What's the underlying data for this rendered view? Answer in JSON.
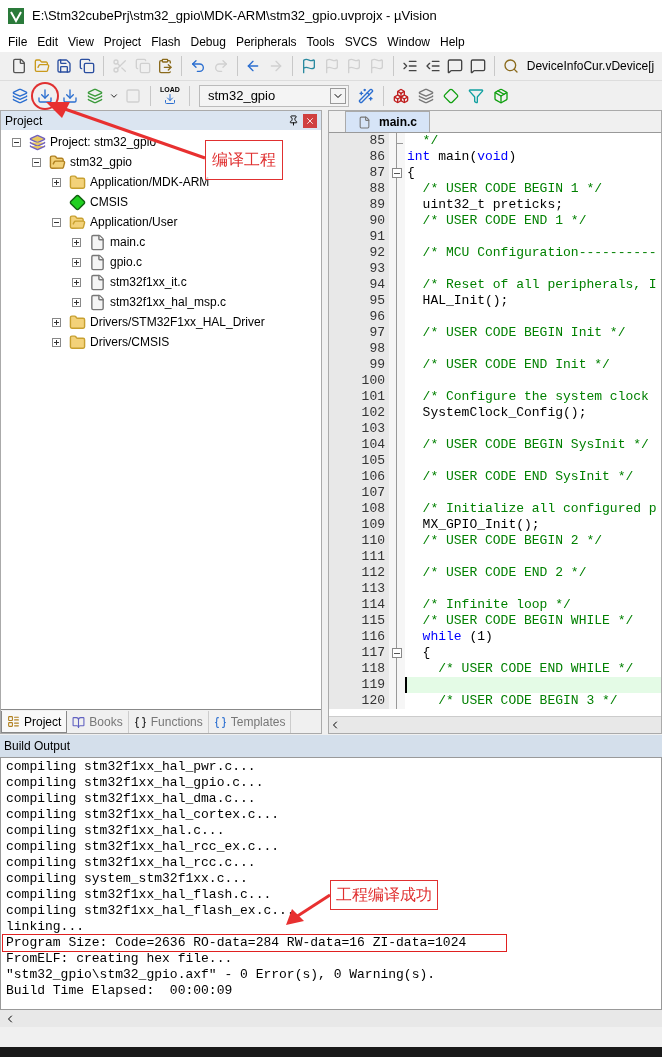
{
  "window": {
    "title": "E:\\Stm32cubePrj\\stm32_gpio\\MDK-ARM\\stm32_gpio.uvprojx - µVision"
  },
  "menu": [
    {
      "label": "File"
    },
    {
      "label": "Edit"
    },
    {
      "label": "View"
    },
    {
      "label": "Project"
    },
    {
      "label": "Flash"
    },
    {
      "label": "Debug"
    },
    {
      "label": "Peripherals"
    },
    {
      "label": "Tools"
    },
    {
      "label": "SVCS"
    },
    {
      "label": "Window"
    },
    {
      "label": "Help"
    }
  ],
  "toolbar1": {
    "buttons": [
      {
        "kind": "new",
        "disabled": false
      },
      {
        "kind": "open",
        "disabled": false
      },
      {
        "kind": "save",
        "disabled": false
      },
      {
        "kind": "saveall",
        "disabled": false
      },
      {
        "kind": "sep"
      },
      {
        "kind": "cut",
        "disabled": true
      },
      {
        "kind": "copy",
        "disabled": true
      },
      {
        "kind": "paste",
        "disabled": false
      },
      {
        "kind": "sep"
      },
      {
        "kind": "undo",
        "disabled": false
      },
      {
        "kind": "redo",
        "disabled": true
      },
      {
        "kind": "sep"
      },
      {
        "kind": "back",
        "disabled": false
      },
      {
        "kind": "forward",
        "disabled": true
      },
      {
        "kind": "sep"
      },
      {
        "kind": "flag",
        "disabled": false
      },
      {
        "kind": "flag",
        "disabled": true
      },
      {
        "kind": "flag",
        "disabled": true
      },
      {
        "kind": "flag",
        "disabled": true
      },
      {
        "kind": "sep"
      },
      {
        "kind": "indent",
        "disabled": false
      },
      {
        "kind": "outdent",
        "disabled": false
      },
      {
        "kind": "comment",
        "disabled": false
      },
      {
        "kind": "comment",
        "disabled": false
      },
      {
        "kind": "sep"
      },
      {
        "kind": "findfolder",
        "disabled": false
      }
    ],
    "device_text": "DeviceInfoCur.vDevice[j"
  },
  "toolbar2": {
    "buttons": [
      {
        "kind": "translate",
        "disabled": false
      },
      {
        "kind": "build",
        "disabled": false,
        "circled": true
      },
      {
        "kind": "rebuild",
        "disabled": false
      },
      {
        "kind": "batch",
        "disabled": false
      },
      {
        "kind": "caret"
      },
      {
        "kind": "stop",
        "disabled": true
      },
      {
        "kind": "sep"
      },
      {
        "kind": "load",
        "disabled": false,
        "label": "LOAD"
      },
      {
        "kind": "sep"
      },
      {
        "kind": "target",
        "value": "stm32_gpio"
      },
      {
        "kind": "wand",
        "disabled": false
      },
      {
        "kind": "sep"
      },
      {
        "kind": "rte",
        "disabled": false
      },
      {
        "kind": "multi",
        "disabled": false
      },
      {
        "kind": "diamond",
        "disabled": false
      },
      {
        "kind": "funnel",
        "disabled": false
      },
      {
        "kind": "pack",
        "disabled": false
      }
    ]
  },
  "project_panel": {
    "title": "Project",
    "tree": [
      {
        "label": "Project: stm32_gpio",
        "kind": "project",
        "expanded": true,
        "children": [
          {
            "label": "stm32_gpio",
            "kind": "target",
            "expanded": true,
            "children": [
              {
                "label": "Application/MDK-ARM",
                "kind": "folder",
                "expanded": false
              },
              {
                "label": "CMSIS",
                "kind": "component"
              },
              {
                "label": "Application/User",
                "kind": "folder",
                "expanded": true,
                "children": [
                  {
                    "label": "main.c",
                    "kind": "file",
                    "expanded": false
                  },
                  {
                    "label": "gpio.c",
                    "kind": "file",
                    "expanded": false
                  },
                  {
                    "label": "stm32f1xx_it.c",
                    "kind": "file",
                    "expanded": false
                  },
                  {
                    "label": "stm32f1xx_hal_msp.c",
                    "kind": "file",
                    "expanded": false
                  }
                ]
              },
              {
                "label": "Drivers/STM32F1xx_HAL_Driver",
                "kind": "folder",
                "expanded": false
              },
              {
                "label": "Drivers/CMSIS",
                "kind": "folder",
                "expanded": false
              }
            ]
          }
        ]
      }
    ],
    "tabs": [
      {
        "label": "Project",
        "kind": "project",
        "selected": true
      },
      {
        "label": "Books",
        "kind": "books",
        "selected": false
      },
      {
        "label": "Functions",
        "kind": "functions",
        "selected": false
      },
      {
        "label": "Templates",
        "kind": "templates",
        "selected": false
      }
    ]
  },
  "editor": {
    "tabs": [
      {
        "label": "main.c",
        "selected": true
      }
    ],
    "lines": [
      {
        "number": "85",
        "kind": "fold_end",
        "segments": [
          {
            "text": "  */",
            "kind": "comment"
          }
        ]
      },
      {
        "number": "86",
        "segments": [
          {
            "text": "int",
            "kind": "keyword"
          },
          {
            "text": " main(",
            "kind": "code"
          },
          {
            "text": "void",
            "kind": "keyword"
          },
          {
            "text": ")",
            "kind": "code"
          }
        ]
      },
      {
        "number": "87",
        "kind": "fold_start",
        "segments": [
          {
            "text": "{",
            "kind": "code"
          }
        ]
      },
      {
        "number": "88",
        "segments": [
          {
            "text": "  /* USER CODE BEGIN 1 */",
            "kind": "comment"
          }
        ]
      },
      {
        "number": "89",
        "segments": [
          {
            "text": "  uint32_t preticks;",
            "kind": "code"
          }
        ]
      },
      {
        "number": "90",
        "segments": [
          {
            "text": "  /* USER CODE END 1 */",
            "kind": "comment"
          }
        ]
      },
      {
        "number": "91"
      },
      {
        "number": "92",
        "segments": [
          {
            "text": "  /* MCU Configuration----------",
            "kind": "comment"
          }
        ]
      },
      {
        "number": "93"
      },
      {
        "number": "94",
        "segments": [
          {
            "text": "  /* Reset of all peripherals, I",
            "kind": "comment"
          }
        ]
      },
      {
        "number": "95",
        "segments": [
          {
            "text": "  HAL_Init();",
            "kind": "code"
          }
        ]
      },
      {
        "number": "96"
      },
      {
        "number": "97",
        "segments": [
          {
            "text": "  /* USER CODE BEGIN Init */",
            "kind": "comment"
          }
        ]
      },
      {
        "number": "98"
      },
      {
        "number": "99",
        "segments": [
          {
            "text": "  /* USER CODE END Init */",
            "kind": "comment"
          }
        ]
      },
      {
        "number": "100"
      },
      {
        "number": "101",
        "segments": [
          {
            "text": "  /* Configure the system clock",
            "kind": "comment"
          }
        ]
      },
      {
        "number": "102",
        "segments": [
          {
            "text": "  SystemClock_Config();",
            "kind": "code"
          }
        ]
      },
      {
        "number": "103"
      },
      {
        "number": "104",
        "segments": [
          {
            "text": "  /* USER CODE BEGIN SysInit */",
            "kind": "comment"
          }
        ]
      },
      {
        "number": "105"
      },
      {
        "number": "106",
        "segments": [
          {
            "text": "  /* USER CODE END SysInit */",
            "kind": "comment"
          }
        ]
      },
      {
        "number": "107"
      },
      {
        "number": "108",
        "segments": [
          {
            "text": "  /* Initialize all configured p",
            "kind": "comment"
          }
        ]
      },
      {
        "number": "109",
        "segments": [
          {
            "text": "  MX_GPIO_Init();",
            "kind": "code"
          }
        ]
      },
      {
        "number": "110",
        "segments": [
          {
            "text": "  /* USER CODE BEGIN 2 */",
            "kind": "comment"
          }
        ]
      },
      {
        "number": "111"
      },
      {
        "number": "112",
        "segments": [
          {
            "text": "  /* USER CODE END 2 */",
            "kind": "comment"
          }
        ]
      },
      {
        "number": "113"
      },
      {
        "number": "114",
        "segments": [
          {
            "text": "  /* Infinite loop */",
            "kind": "comment"
          }
        ]
      },
      {
        "number": "115",
        "segments": [
          {
            "text": "  /* USER CODE BEGIN WHILE */",
            "kind": "comment"
          }
        ]
      },
      {
        "number": "116",
        "segments": [
          {
            "text": "  while",
            "kind": "keyword"
          },
          {
            "text": " (1)",
            "kind": "code"
          }
        ]
      },
      {
        "number": "117",
        "kind": "fold_start",
        "segments": [
          {
            "text": "  {",
            "kind": "code"
          }
        ]
      },
      {
        "number": "118",
        "segments": [
          {
            "text": "    /* USER CODE END WHILE */",
            "kind": "comment"
          }
        ]
      },
      {
        "number": "119",
        "current": true
      },
      {
        "number": "120",
        "segments": [
          {
            "text": "    /* USER CODE BEGIN 3 */",
            "kind": "comment"
          }
        ]
      }
    ]
  },
  "build_output": {
    "title": "Build Output",
    "lines": [
      {
        "text": "compiling stm32f1xx_hal_pwr.c..."
      },
      {
        "text": "compiling stm32f1xx_hal_gpio.c..."
      },
      {
        "text": "compiling stm32f1xx_hal_dma.c..."
      },
      {
        "text": "compiling stm32f1xx_hal_cortex.c..."
      },
      {
        "text": "compiling stm32f1xx_hal.c..."
      },
      {
        "text": "compiling stm32f1xx_hal_rcc_ex.c..."
      },
      {
        "text": "compiling stm32f1xx_hal_rcc.c..."
      },
      {
        "text": "compiling system_stm32f1xx.c..."
      },
      {
        "text": "compiling stm32f1xx_hal_flash.c..."
      },
      {
        "text": "compiling stm32f1xx_hal_flash_ex.c..."
      },
      {
        "text": "linking..."
      },
      {
        "text": "Program Size: Code=2636 RO-data=284 RW-data=16 ZI-data=1024",
        "highlighted": true
      },
      {
        "text": "FromELF: creating hex file..."
      },
      {
        "text": "\"stm32_gpio\\stm32_gpio.axf\" - 0 Error(s), 0 Warning(s)."
      },
      {
        "text": "Build Time Elapsed:  00:00:09"
      }
    ]
  },
  "annotations": [
    {
      "kind": "build",
      "text": "编译工程"
    },
    {
      "kind": "success",
      "text": "工程编译成功"
    }
  ]
}
